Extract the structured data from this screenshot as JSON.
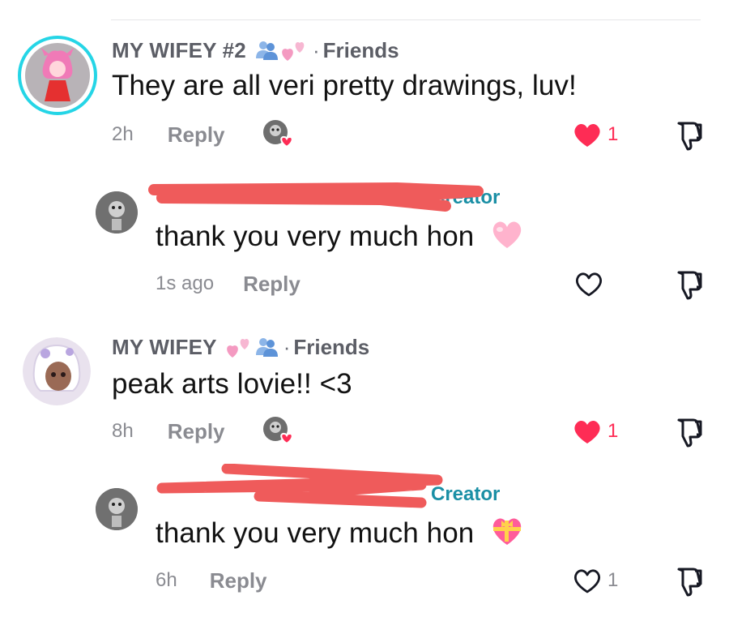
{
  "comments": [
    {
      "username": "MY WIFEY #2",
      "relation": "Friends",
      "separator": "·",
      "text": "They are all veri pretty drawings, luv!",
      "time": "2h",
      "reply_label": "Reply",
      "likes": "1",
      "liked": true,
      "creator_liked": true,
      "avatar_icon": "anime-pink-character-avatar"
    },
    {
      "username_redacted": true,
      "tag": "Creator",
      "text": "thank you very much hon",
      "emoji": "pink-heart",
      "time": "1s ago",
      "reply_label": "Reply",
      "likes": "",
      "liked": false
    },
    {
      "username": "MY WIFEY",
      "relation": "Friends",
      "separator": "·",
      "text": "peak arts lovie!! <3",
      "time": "8h",
      "reply_label": "Reply",
      "likes": "1",
      "liked": true,
      "creator_liked": true,
      "avatar_icon": "anime-white-hair-character-avatar"
    },
    {
      "username_redacted": true,
      "tag": "Creator",
      "text": "thank you very much hon",
      "emoji": "heart-with-ribbon",
      "time": "6h",
      "reply_label": "Reply",
      "likes": "1",
      "liked": false
    }
  ],
  "colors": {
    "like_active": "#fe2c55",
    "creator_tag": "#1a8fa5",
    "avatar_ring": "#25d5e6",
    "redaction": "#ef5b5b"
  }
}
